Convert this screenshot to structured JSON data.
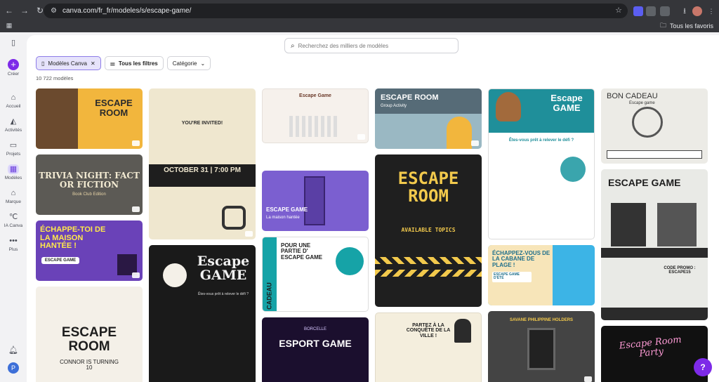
{
  "browser": {
    "url": "canva.com/fr_fr/modeles/s/escape-game/",
    "bookmarks_label": "Tous les favoris"
  },
  "rail": {
    "create": "Créer",
    "items": [
      {
        "label": "Accueil",
        "icon": "home-icon"
      },
      {
        "label": "Activités",
        "icon": "activity-icon"
      },
      {
        "label": "Projets",
        "icon": "folder-icon"
      },
      {
        "label": "Modèles",
        "icon": "templates-icon",
        "active": true
      },
      {
        "label": "Marque",
        "icon": "brand-icon"
      },
      {
        "label": "IA Canva",
        "icon": "ai-icon"
      },
      {
        "label": "Plus",
        "icon": "more-icon"
      }
    ],
    "avatar_letter": "P"
  },
  "search": {
    "placeholder": "Recherchez des milliers de modèles"
  },
  "filters": {
    "canva_models": "Modèles Canva",
    "all_filters": "Tous les filtres",
    "category": "Catégorie"
  },
  "results_count": "10 722 modèles",
  "help_label": "?",
  "cards": [
    {
      "title": "ESCAPE ROOM",
      "subtitle": "",
      "bg": "#f2b63d",
      "fg": "#2b2b2b"
    },
    {
      "title": "TRIVIA NIGHT: FACT OR FICTION",
      "subtitle": "Book Club Edition",
      "bg": "#5c5a55",
      "fg": "#f2ead2"
    },
    {
      "title": "ÉCHAPPE-TOI DE LA MAISON HANTÉE !",
      "subtitle": "ESCAPE GAME",
      "bg": "#6a42b8",
      "fg": "#ffe94a"
    },
    {
      "title": "ESCAPE ROOM",
      "subtitle": "CONNOR IS TURNING 10",
      "bg": "#f4f0e8",
      "fg": "#1e1e1e"
    },
    {
      "title": "YOU'RE INVITED!",
      "subtitle": "OCTOBER 31 | 7:00 PM",
      "bg": "#efe7cf",
      "fg": "#2b2b2b"
    },
    {
      "title": "Escape GAME",
      "subtitle": "Êtes-vous prêt à relever le défi ?",
      "bg": "#1a1a1a",
      "fg": "#f1f1f1"
    },
    {
      "title": "Escape Game",
      "subtitle": "",
      "bg": "#f6f1ec",
      "fg": "#6b3a2a"
    },
    {
      "title": "ESCAPE GAME",
      "subtitle": "La maison hantée",
      "bg": "#7b5fd0",
      "fg": "#ffffff"
    },
    {
      "title": "BON CADEAU",
      "subtitle": "POUR UNE PARTIE D' ESCAPE GAME",
      "bg": "#16a3a7",
      "fg": "#1e1e1e"
    },
    {
      "title": "ESPORT GAME",
      "subtitle": "BORCELLE",
      "bg": "#1b0f2e",
      "fg": "#ffffff"
    },
    {
      "title": "ESCAPE ROOM",
      "subtitle": "Group Activity",
      "bg": "#9ab8c3",
      "fg": "#ffffff"
    },
    {
      "title": "ESCAPE ROOM",
      "subtitle": "AVAILABLE TOPICS",
      "bg": "#1f1f1f",
      "fg": "#f2c94c"
    },
    {
      "title": "PARTEZ À LA CONQUÊTE DE LA VILLE !",
      "subtitle": "",
      "bg": "#f4eedd",
      "fg": "#1e1e1e"
    },
    {
      "title": "Escape GAME",
      "subtitle": "Êtes-vous prêt à relever le défi ?",
      "bg": "#1f8f9a",
      "fg": "#ffffff"
    },
    {
      "title": "ÉCHAPPEZ-VOUS DE LA CABANE DE PLAGE !",
      "subtitle": "ESCAPE GAME D'ÉTÉ",
      "bg": "#3cb4e6",
      "fg": "#ffffff"
    },
    {
      "title": "SAVANE PHILIPPINE HOLDERS",
      "subtitle": "",
      "bg": "#444",
      "fg": "#f2c94c"
    },
    {
      "title": "BON CADEAU",
      "subtitle": "Escape game",
      "bg": "#ecebe6",
      "fg": "#333"
    },
    {
      "title": "ESCAPE GAME",
      "subtitle": "CODE PROMO : ESCAPE15",
      "bg": "#e9eae6",
      "fg": "#1e1e1e"
    },
    {
      "title": "Escape Room Party",
      "subtitle": "",
      "bg": "#111",
      "fg": "#ff9bd6"
    }
  ]
}
